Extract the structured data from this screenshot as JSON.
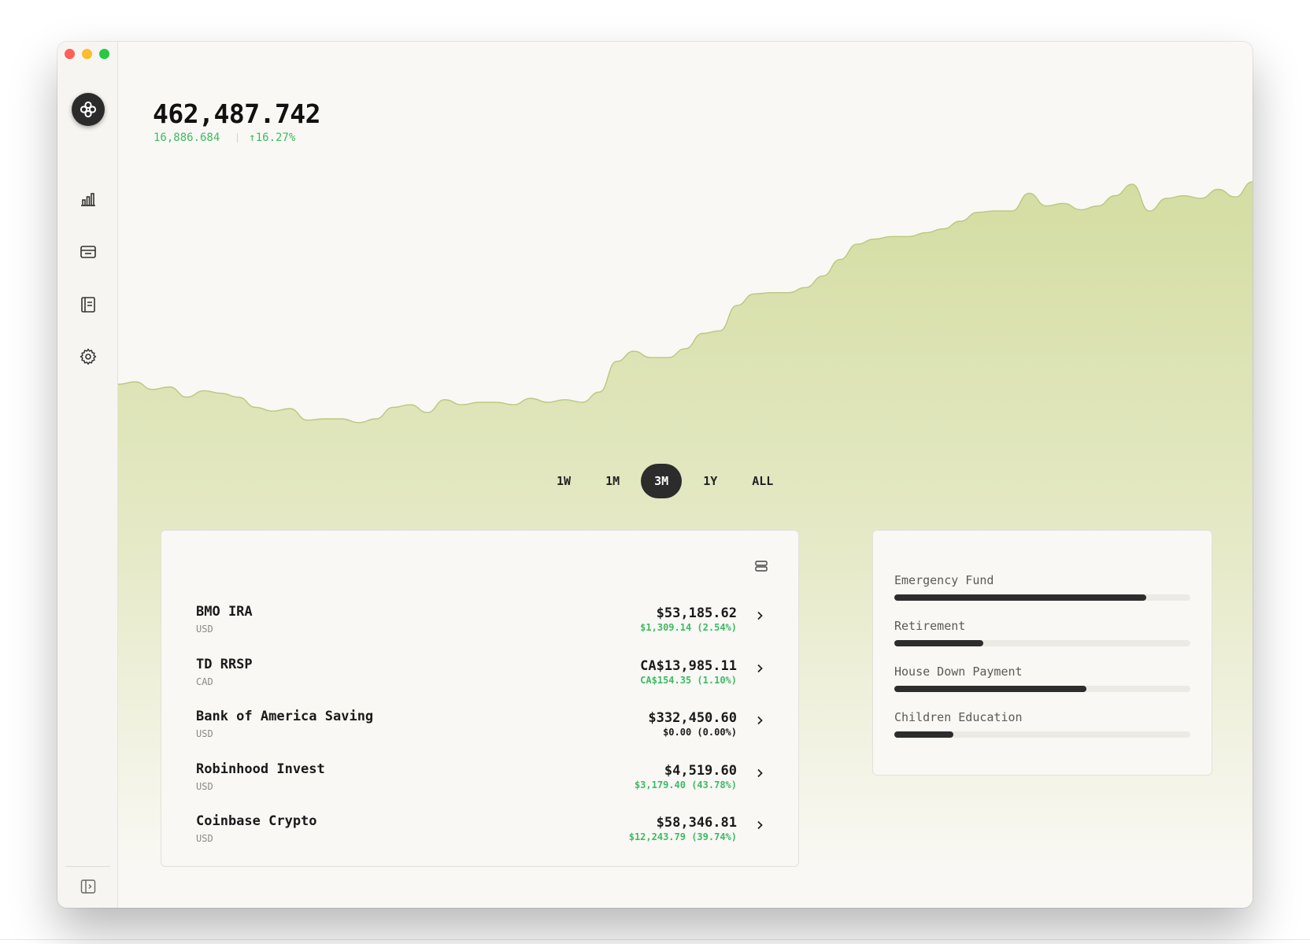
{
  "sidebar": {
    "items": [
      {
        "name": "dashboard",
        "icon": "bar-chart-icon"
      },
      {
        "name": "accounts",
        "icon": "wallet-icon"
      },
      {
        "name": "reports",
        "icon": "ledger-icon"
      },
      {
        "name": "settings",
        "icon": "gear-icon"
      }
    ],
    "toggle_icon": "sidebar-toggle-icon",
    "logo_icon": "app-logo-icon"
  },
  "header": {
    "balance": "462,487.742",
    "change_amount": "16,886.684",
    "change_percent": "↑16.27%"
  },
  "chart_data": {
    "type": "area",
    "title": "",
    "xlabel": "",
    "ylabel": "",
    "range": "3M",
    "series": [
      {
        "values": [
          420,
          422,
          416,
          418,
          410,
          415,
          413,
          410,
          402,
          399,
          401,
          392,
          393,
          393,
          390,
          393,
          402,
          404,
          398,
          408,
          404,
          406,
          406,
          404,
          409,
          406,
          408,
          406,
          414,
          438,
          446,
          441,
          441,
          448,
          460,
          462,
          482,
          491,
          492,
          492,
          496,
          505,
          518,
          530,
          534,
          536,
          536,
          539,
          542,
          548,
          555,
          556,
          556,
          570,
          560,
          562,
          557,
          560,
          568,
          577,
          556,
          566,
          568,
          566,
          573,
          567,
          579
        ]
      }
    ],
    "fill_color": "#d6dfa6",
    "line_color": "#b9c87e"
  },
  "range_tabs": [
    {
      "label": "1W",
      "active": false
    },
    {
      "label": "1M",
      "active": false
    },
    {
      "label": "3M",
      "active": true
    },
    {
      "label": "1Y",
      "active": false
    },
    {
      "label": "ALL",
      "active": false
    }
  ],
  "accounts": {
    "menu_icon": "layers-icon",
    "rows": [
      {
        "name": "BMO IRA",
        "currency": "USD",
        "amount": "$53,185.62",
        "change": "$1,309.14 (2.54%)",
        "positive": true
      },
      {
        "name": "TD RRSP",
        "currency": "CAD",
        "amount": "CA$13,985.11",
        "change": "CA$154.35 (1.10%)",
        "positive": true
      },
      {
        "name": "Bank of America Saving",
        "currency": "USD",
        "amount": "$332,450.60",
        "change": "$0.00 (0.00%)",
        "positive": false
      },
      {
        "name": "Robinhood Invest",
        "currency": "USD",
        "amount": "$4,519.60",
        "change": "$3,179.40 (43.78%)",
        "positive": true
      },
      {
        "name": "Coinbase Crypto",
        "currency": "USD",
        "amount": "$58,346.81",
        "change": "$12,243.79 (39.74%)",
        "positive": true
      }
    ]
  },
  "goals": [
    {
      "label": "Emergency Fund",
      "progress": 0.85
    },
    {
      "label": "Retirement",
      "progress": 0.3
    },
    {
      "label": "House Down Payment",
      "progress": 0.65
    },
    {
      "label": "Children Education",
      "progress": 0.2
    }
  ],
  "colors": {
    "positive": "#3dbb63",
    "dark": "#2c2c2c"
  }
}
